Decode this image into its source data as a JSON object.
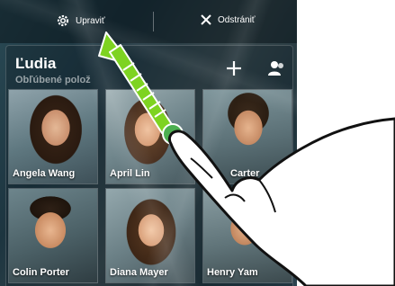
{
  "toolbar": {
    "edit_label": "Upraviť",
    "edit_icon": "gear-icon",
    "remove_label": "Odstrániť",
    "remove_icon": "close-icon"
  },
  "header": {
    "title": "Ľudia",
    "subtitle": "Obľúbené polož",
    "add_icon": "plus-icon",
    "people_icon": "add-person-icon"
  },
  "contacts": [
    {
      "name": "Angela Wang"
    },
    {
      "name": "April Lin"
    },
    {
      "name": "Carter"
    },
    {
      "name": "Colin Porter"
    },
    {
      "name": "Diana Mayer"
    },
    {
      "name": "Henry Yam"
    }
  ],
  "gesture": {
    "arrow_color": "#7ed321",
    "touch_color": "#4caf50"
  }
}
